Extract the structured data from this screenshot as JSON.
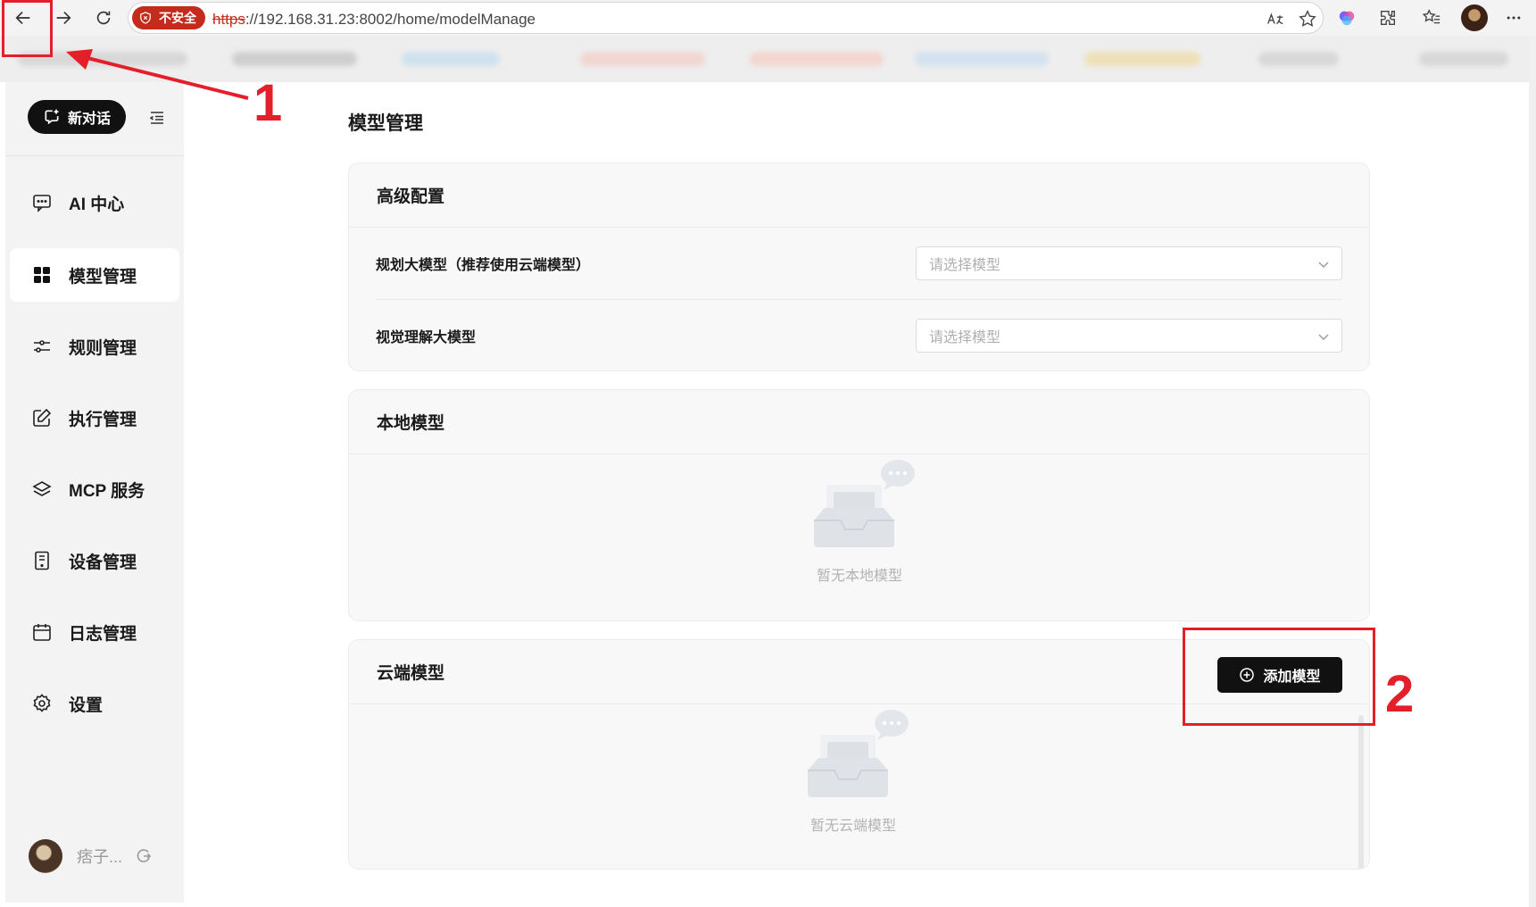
{
  "browser": {
    "insecure_label": "不安全",
    "url_scheme": "https",
    "url_rest": "://192.168.31.23:8002/home/modelManage"
  },
  "sidebar": {
    "new_chat_label": "新对话",
    "items": [
      {
        "label": "AI 中心",
        "icon": "chat-icon"
      },
      {
        "label": "模型管理",
        "icon": "grid-icon"
      },
      {
        "label": "规则管理",
        "icon": "sliders-icon"
      },
      {
        "label": "执行管理",
        "icon": "edit-icon"
      },
      {
        "label": "MCP 服务",
        "icon": "layers-icon"
      },
      {
        "label": "设备管理",
        "icon": "device-icon"
      },
      {
        "label": "日志管理",
        "icon": "calendar-icon"
      },
      {
        "label": "设置",
        "icon": "gear-icon"
      }
    ],
    "user_name": "痞子..."
  },
  "main": {
    "page_title": "模型管理",
    "advanced": {
      "title": "高级配置",
      "rows": [
        {
          "label": "规划大模型（推荐使用云端模型）",
          "placeholder": "请选择模型"
        },
        {
          "label": "视觉理解大模型",
          "placeholder": "请选择模型"
        }
      ]
    },
    "local": {
      "title": "本地模型",
      "empty_text": "暂无本地模型"
    },
    "cloud": {
      "title": "云端模型",
      "add_button_label": "添加模型",
      "empty_text": "暂无云端模型"
    }
  },
  "annotations": {
    "label_1": "1",
    "label_2": "2",
    "color": "#e41f2a"
  }
}
